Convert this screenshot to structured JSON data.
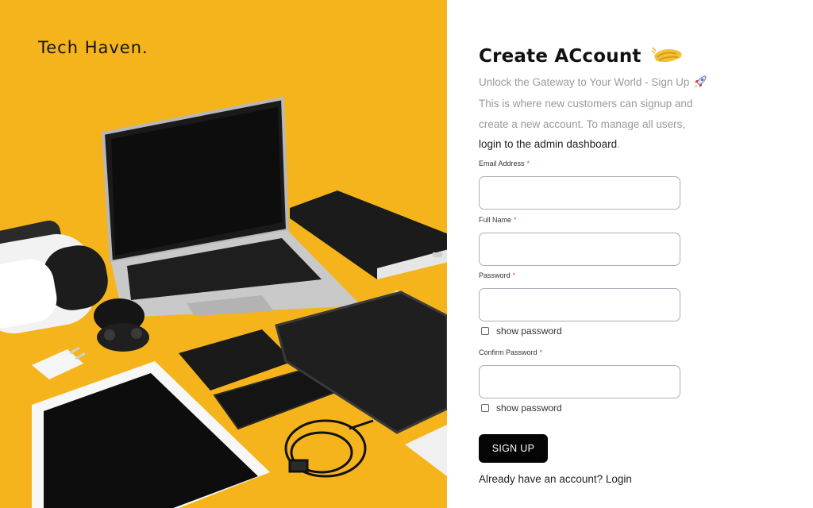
{
  "brand": {
    "name": "Tech Haven."
  },
  "form": {
    "title": "Create ACcount",
    "title_icon": "waving-hands-icon",
    "subtitle": "Unlock the Gateway to Your World - Sign Up",
    "subtitle_icon": "rocket-icon",
    "description_prefix": "This is where new customers can signup and create a new account. To manage all users,",
    "description_link": "login to the admin dashboard",
    "description_suffix": ".",
    "required_mark": "*",
    "fields": {
      "email": {
        "label": "Email Address",
        "value": "",
        "placeholder": ""
      },
      "full_name": {
        "label": "Full Name",
        "value": "",
        "placeholder": ""
      },
      "password": {
        "label": "Password",
        "value": "",
        "placeholder": ""
      },
      "confirm_password": {
        "label": "Confirm Password",
        "value": "",
        "placeholder": ""
      }
    },
    "show_password_label": "show password",
    "show_confirm_password_label": "show password",
    "submit_label": "SIGN UP",
    "login_prompt": "Already have an account?",
    "login_link": "Login"
  },
  "colors": {
    "hero_background": "#f5b41c",
    "button_background": "#050505",
    "required": "#e05050",
    "muted_text": "#9a9a9a"
  }
}
